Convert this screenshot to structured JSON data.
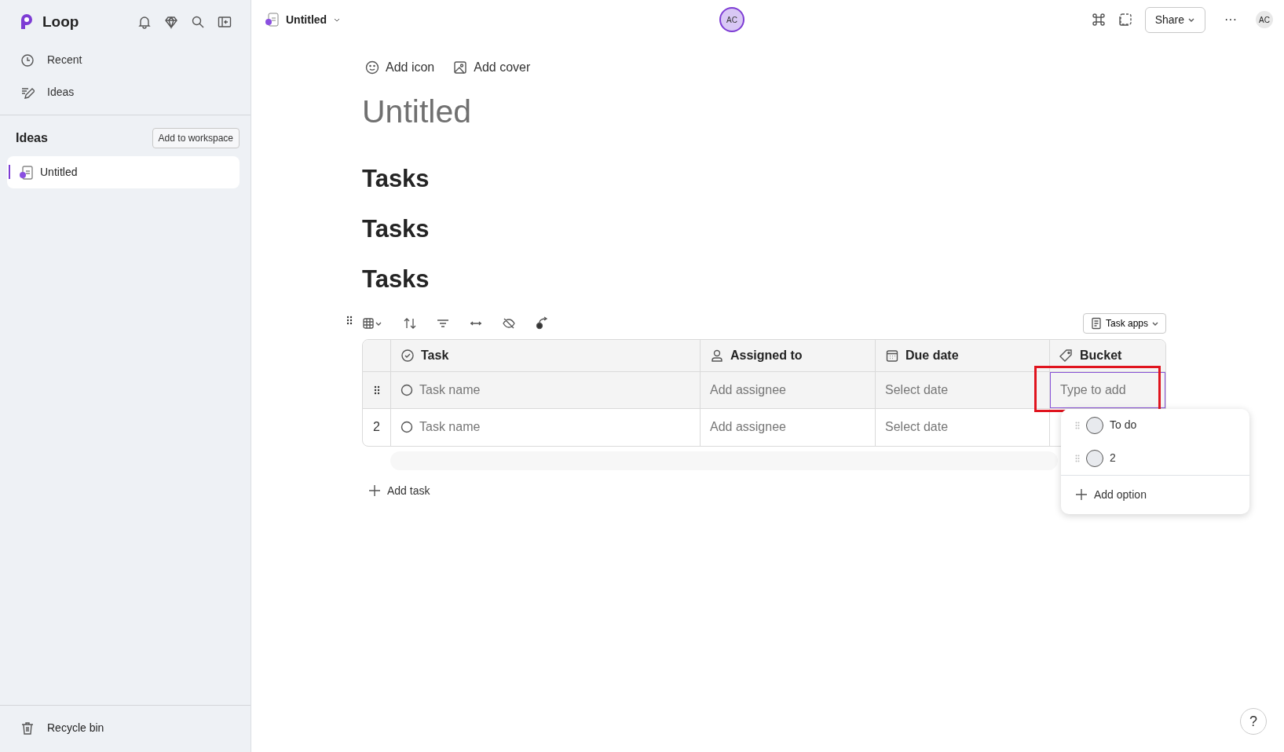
{
  "sidebar": {
    "app_name": "Loop",
    "nav": [
      {
        "label": "Recent",
        "kind": "recent"
      },
      {
        "label": "Ideas",
        "kind": "ideas"
      }
    ],
    "section": {
      "title": "Ideas",
      "button": "Add to workspace"
    },
    "pages": [
      {
        "label": "Untitled",
        "selected": true
      }
    ],
    "footer": {
      "label": "Recycle bin"
    }
  },
  "topbar": {
    "page_title": "Untitled",
    "presence_avatar": "AC",
    "share": "Share",
    "more": "···",
    "user_avatar": "AC"
  },
  "page": {
    "actions": [
      {
        "label": "Add icon",
        "kind": "icon"
      },
      {
        "label": "Add cover",
        "kind": "cover"
      }
    ],
    "title_placeholder": "Untitled",
    "headings": [
      "Tasks",
      "Tasks",
      "Tasks"
    ],
    "table": {
      "apps_button": "Task apps",
      "columns": [
        {
          "label": "Task",
          "kind": "task"
        },
        {
          "label": "Assigned to",
          "kind": "person"
        },
        {
          "label": "Due date",
          "kind": "date"
        },
        {
          "label": "Bucket",
          "kind": "tag"
        }
      ],
      "rows": [
        {
          "hovered": true,
          "task": "Task name",
          "assignee": "Add assignee",
          "due": "Select date",
          "bucket_placeholder": "Type to add",
          "bucket_highlighted": true
        },
        {
          "hovered": false,
          "number": "2",
          "task": "Task name",
          "assignee": "Add assignee",
          "due": "Select date"
        }
      ],
      "add_task": "Add task",
      "dropdown": {
        "options": [
          {
            "label": "To do"
          },
          {
            "label": "2"
          }
        ],
        "add_option": "Add option"
      }
    },
    "help": "?"
  }
}
